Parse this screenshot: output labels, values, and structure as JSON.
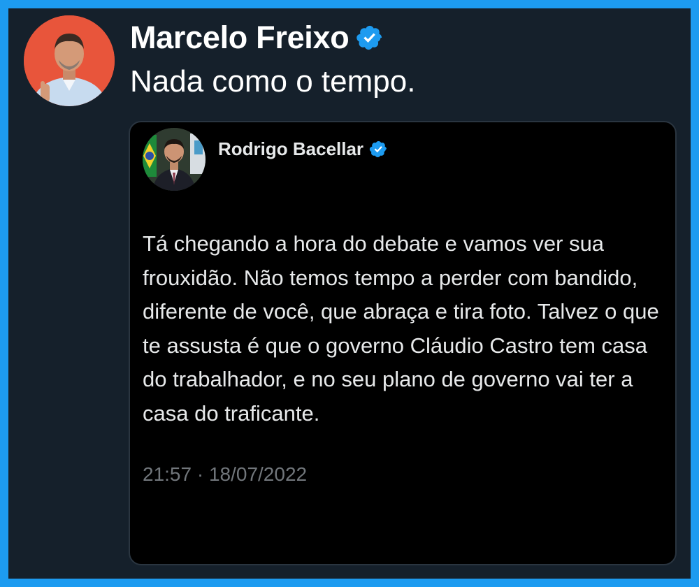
{
  "tweet": {
    "author_name": "Marcelo Freixo",
    "verified_icon": "verified-badge-icon",
    "text": "Nada como o tempo."
  },
  "quoted_tweet": {
    "author_name": "Rodrigo Bacellar",
    "verified_icon": "verified-badge-icon",
    "text": "Tá chegando a hora do debate e vamos ver sua frouxidão. Não temos tempo a perder com bandido, diferente de você, que abraça e tira foto. Talvez o que te assusta é que o governo Cláudio Castro tem casa do trabalhador, e no seu plano de governo vai ter a casa do traficante.",
    "timestamp": "21:57 · 18/07/2022"
  },
  "colors": {
    "frame_border": "#1d9bf0",
    "background": "#15202b",
    "quote_background": "#000000",
    "verified": "#1d9bf0",
    "timestamp": "#71767b"
  }
}
